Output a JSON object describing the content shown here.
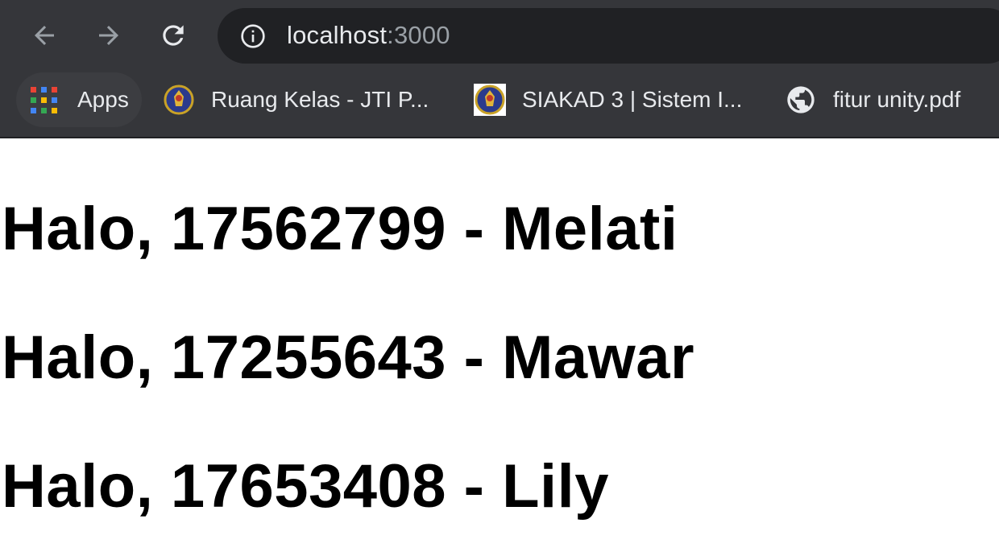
{
  "browser": {
    "url_host": "localhost",
    "url_port": ":3000"
  },
  "bookmarks": {
    "apps_label": "Apps",
    "items": [
      {
        "label": "Ruang Kelas - JTI P...",
        "icon": "university-emblem-icon"
      },
      {
        "label": "SIAKAD 3 | Sistem I...",
        "icon": "university-emblem-icon"
      },
      {
        "label": "fitur unity.pdf",
        "icon": "globe-icon"
      }
    ]
  },
  "page": {
    "greetings": [
      {
        "text": "Halo, 17562799 - Melati"
      },
      {
        "text": "Halo, 17255643 - Mawar"
      },
      {
        "text": "Halo, 17653408 - Lily"
      }
    ]
  },
  "colors": {
    "chrome_bg": "#35363a",
    "omnibox_bg": "#202124",
    "text_light": "#e8eaed",
    "text_muted": "#9aa0a6"
  }
}
